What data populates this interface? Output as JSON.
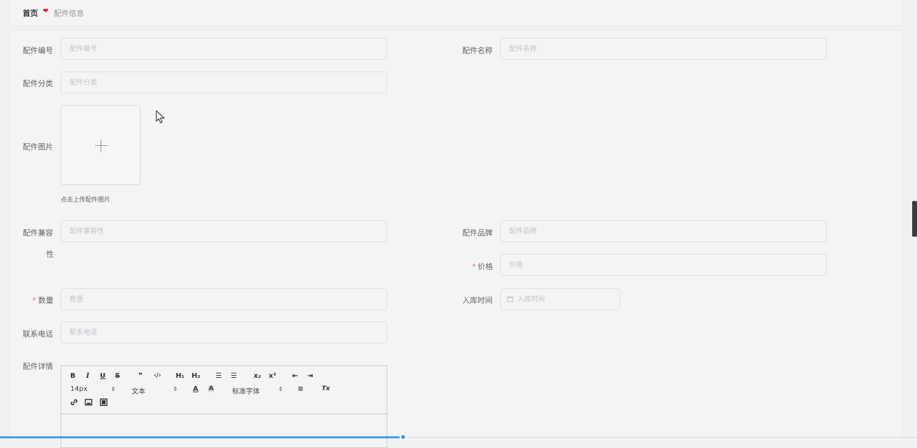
{
  "breadcrumb": {
    "home": "首页",
    "separator_icon": "heart-icon",
    "current": "配件信息"
  },
  "form": {
    "code": {
      "label": "配件编号",
      "placeholder": "配件编号",
      "value": ""
    },
    "name": {
      "label": "配件名称",
      "placeholder": "配件名称",
      "value": ""
    },
    "category": {
      "label": "配件分类",
      "placeholder": "配件分类",
      "value": ""
    },
    "image": {
      "label": "配件图片",
      "tip": "点击上传配件图片"
    },
    "compat": {
      "label_line1": "配件兼容",
      "label_line2": "性",
      "placeholder": "配件兼容性",
      "value": ""
    },
    "brand": {
      "label": "配件品牌",
      "placeholder": "配件品牌",
      "value": ""
    },
    "price": {
      "required_mark": "*",
      "label": "价格",
      "placeholder": "价格",
      "value": ""
    },
    "quantity": {
      "required_mark": "*",
      "label": "数量",
      "placeholder": "数量",
      "value": ""
    },
    "stock_time": {
      "label": "入库时间",
      "placeholder": "入库时间",
      "value": ""
    },
    "phone": {
      "label": "联系电话",
      "placeholder": "联系电话",
      "value": ""
    },
    "detail": {
      "label": "配件详情"
    }
  },
  "editor_toolbar": {
    "bold": "B",
    "italic": "I",
    "underline": "U",
    "strike": "S",
    "blockquote": "❞",
    "code": "‹/›",
    "h1": "H₁",
    "h2": "H₂",
    "ordered_list": "☰",
    "bullet_list": "☰",
    "subscript": "x₂",
    "superscript": "x²",
    "indent_dec": "⇤",
    "indent_inc": "⇥",
    "size_value": "14px",
    "header_value": "文本",
    "font_color": "A",
    "bg_color": "A",
    "font_value": "标准字体",
    "align": "≡",
    "clean": "Tx",
    "link_icon": "link-icon",
    "image_icon": "image-icon",
    "video_icon": "video-icon"
  },
  "colors": {
    "accent": "#409eff",
    "required": "#f56c6c",
    "heart": "#e0211f"
  }
}
